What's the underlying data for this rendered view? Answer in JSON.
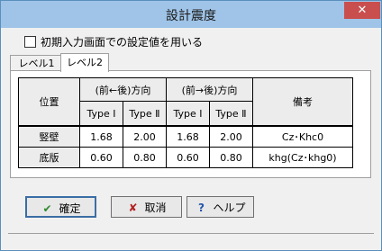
{
  "window": {
    "title": "設計震度",
    "close_label": "✕"
  },
  "option": {
    "label": "初期入力画面での設定値を用いる"
  },
  "tabs": [
    {
      "label": "レベル1"
    },
    {
      "label": "レベル2"
    }
  ],
  "table": {
    "header": {
      "position": "位置",
      "front_back": "(前←後)方向",
      "back_front": "(前→後)方向",
      "remarks": "備考"
    },
    "types": [
      "Type Ⅰ",
      "Type Ⅱ",
      "Type Ⅰ",
      "Type Ⅱ"
    ],
    "rows": [
      {
        "name": "竪壁",
        "values": [
          "1.68",
          "2.00",
          "1.68",
          "2.00"
        ],
        "remark": "Cz･Khc0"
      },
      {
        "name": "底版",
        "values": [
          "0.60",
          "0.80",
          "0.60",
          "0.80"
        ],
        "remark": "khg(Cz･khg0)"
      }
    ]
  },
  "buttons": {
    "ok": "確定",
    "cancel": "取消",
    "help": "ヘルプ"
  },
  "icons": {
    "ok": "check-icon",
    "cancel": "x-icon",
    "help": "question-icon"
  },
  "colors": {
    "ok_icon": "#2e8b2e",
    "cancel_icon": "#b22222",
    "help_icon": "#2255aa"
  }
}
